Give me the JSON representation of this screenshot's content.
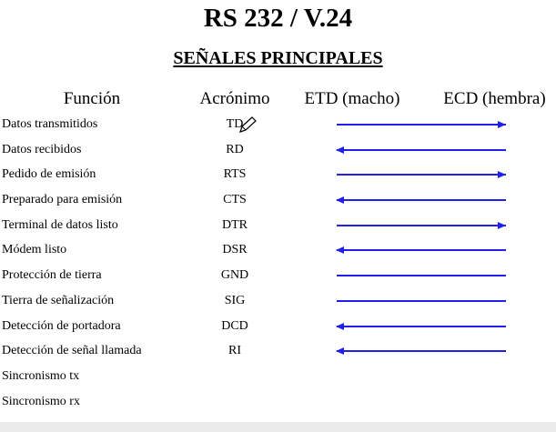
{
  "title": "RS 232 / V.24",
  "subtitle": "SEÑALES PRINCIPALES",
  "headers": {
    "funcion": "Función",
    "acronimo": "Acrónimo",
    "etd": "ETD (macho)",
    "ecd": "ECD (hembra)"
  },
  "arrow_color": "#2020e8",
  "rows": [
    {
      "funcion": "Datos transmitidos",
      "acronimo": "TD",
      "arrow": "right"
    },
    {
      "funcion": "Datos recibidos",
      "acronimo": "RD",
      "arrow": "left"
    },
    {
      "funcion": "Pedido de emisión",
      "acronimo": "RTS",
      "arrow": "right"
    },
    {
      "funcion": "Preparado para emisión",
      "acronimo": "CTS",
      "arrow": "left"
    },
    {
      "funcion": "Terminal de datos listo",
      "acronimo": "DTR",
      "arrow": "right"
    },
    {
      "funcion": "Módem listo",
      "acronimo": "DSR",
      "arrow": "left"
    },
    {
      "funcion": "Protección de tierra",
      "acronimo": "GND",
      "arrow": "none"
    },
    {
      "funcion": "Tierra de señalización",
      "acronimo": "SIG",
      "arrow": "none"
    },
    {
      "funcion": "Detección de portadora",
      "acronimo": "DCD",
      "arrow": "left"
    },
    {
      "funcion": "Detección de señal llamada",
      "acronimo": "RI",
      "arrow": "left"
    },
    {
      "funcion": "Sincronismo tx",
      "acronimo": "",
      "arrow": "blank"
    },
    {
      "funcion": "Sincronismo rx",
      "acronimo": "",
      "arrow": "blank"
    }
  ]
}
